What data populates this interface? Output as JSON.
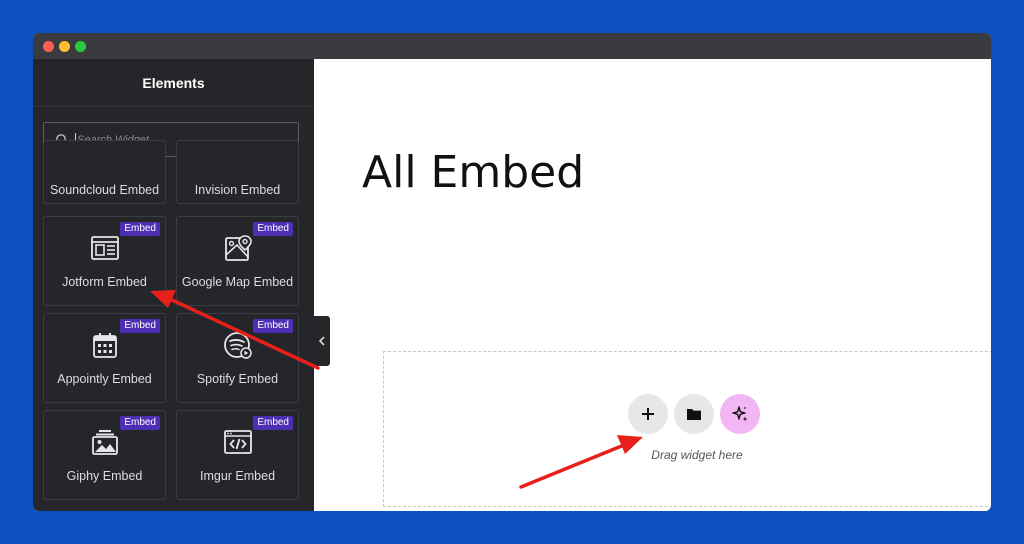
{
  "sidebar": {
    "title": "Elements",
    "search": {
      "placeholder": "Search Widget...",
      "value": ""
    },
    "widgets": [
      {
        "label": "Soundcloud Embed",
        "badge": "",
        "icon": "soundcloud-icon"
      },
      {
        "label": "Invision Embed",
        "badge": "",
        "icon": "invision-icon"
      },
      {
        "label": "Jotform Embed",
        "badge": "Embed",
        "icon": "form-icon"
      },
      {
        "label": "Google Map Embed",
        "badge": "Embed",
        "icon": "map-icon"
      },
      {
        "label": "Appointly Embed",
        "badge": "Embed",
        "icon": "calendar-icon"
      },
      {
        "label": "Spotify Embed",
        "badge": "Embed",
        "icon": "spotify-icon"
      },
      {
        "label": "Giphy Embed",
        "badge": "Embed",
        "icon": "image-icon"
      },
      {
        "label": "Imgur Embed",
        "badge": "Embed",
        "icon": "code-window-icon"
      }
    ]
  },
  "canvas": {
    "heading": "All Embed",
    "dropzone": {
      "buttons": [
        "add-section-icon",
        "template-folder-icon",
        "ai-sparkle-icon"
      ],
      "hint": "Drag widget here"
    }
  },
  "colors": {
    "background": "#0b4fc0",
    "sidebar": "#25262a",
    "badge": "#4e2fb3",
    "annotation_arrow": "#e8201b",
    "ai_button": "#f2b6f4"
  }
}
